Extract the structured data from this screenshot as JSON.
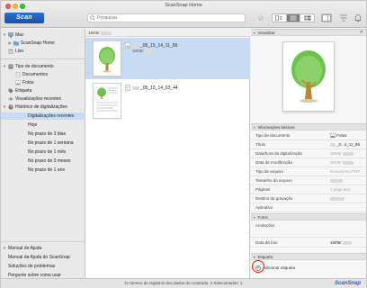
{
  "window": {
    "title": "ScanSnap Home"
  },
  "toolbar": {
    "scan_label": "Scan",
    "search_placeholder": "Pesquisar",
    "icons": [
      "star-icon",
      "thumbnail-view-icon",
      "list-view-icon",
      "detail-view-icon",
      "panel-toggle-icon",
      "sort-icon",
      "notification-icon"
    ]
  },
  "sidebar": {
    "computer": [
      {
        "label": "Mac",
        "icon": "computer-icon"
      },
      {
        "label": "ScanSnap Home",
        "icon": "folder-icon"
      },
      {
        "label": "Lixo",
        "icon": "trash-icon"
      }
    ],
    "doc_type": {
      "label": "Tipo de documento",
      "items": [
        "Documentos",
        "Fotos"
      ]
    },
    "other": [
      {
        "label": "Etiqueta",
        "icon": "tag-icon"
      },
      {
        "label": "Visualizações recentes",
        "icon": "eye-icon"
      }
    ],
    "history": {
      "label": "Histórico de digitalizações",
      "items": [
        "Digitalizações recentes",
        "Hoje",
        "No prazo de 3 dias",
        "No prazo de 1 semana",
        "No prazo de 1 mês",
        "No prazo de 3 meses",
        "No prazo de 1 ano"
      ]
    },
    "help": {
      "label": "Manual de Ajuda",
      "items": [
        "Manual da Ajuda do ScanSnap",
        "Soluções de problemas",
        "Pergunte sobre como usar"
      ]
    }
  },
  "list": {
    "header": "15/05/",
    "rows": [
      {
        "name": "_05_15_14_11_56",
        "sub": "15/05/"
      },
      {
        "name": "_05_15_14_03_44",
        "sub": ""
      }
    ]
  },
  "panel": {
    "preview_label": "Visualizar",
    "info_label": "Informações básicas",
    "info": [
      {
        "key": "Tipo de documento",
        "value": "Fotos"
      },
      {
        "key": "Título",
        "value": "_0...4_11_56"
      },
      {
        "key": "Data/hora da digitalização",
        "value": "15/05/"
      },
      {
        "key": "Data de modificação",
        "value": "15/05/"
      },
      {
        "key": "Tipo de arquivo",
        "value": "Documento PDF"
      },
      {
        "key": "Tamanho do arquivo",
        "value": ""
      },
      {
        "key": "Páginas",
        "value": "1 página(s)"
      },
      {
        "key": "Destino da gravação",
        "value": ""
      },
      {
        "key": "Aplicativo",
        "value": ""
      }
    ],
    "photos_label": "Fotos",
    "photos": [
      {
        "key": "Anotações",
        "value": ""
      },
      {
        "key": "Data da foto",
        "value": "15/05/"
      }
    ],
    "tag_label": "Etiqueta",
    "add_tag": "Adicionar etiqueta"
  },
  "status": {
    "text": "O número de registros dos dados do conteúdo: 2  Selecionados: 1",
    "brand": "ScanSnap"
  },
  "colors": {
    "selection": "#c7dcf3",
    "scan_button": "#1a5fc0",
    "tree_green": "#6cc24a",
    "tree_trunk": "#b9863f",
    "sky_blue": "#5aa7e8",
    "highlight_red": "#e11111"
  }
}
